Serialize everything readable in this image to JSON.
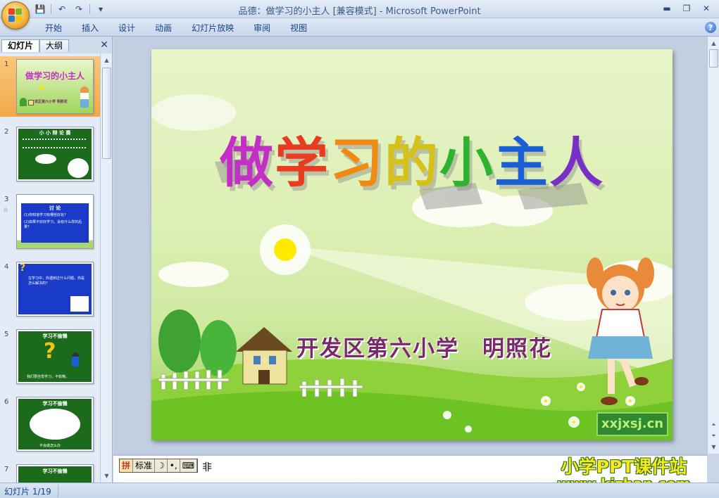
{
  "window": {
    "title": "品德：做学习的小主人 [兼容模式] - Microsoft PowerPoint",
    "minimize": "▬",
    "restore": "❐",
    "close": "✕"
  },
  "qat": {
    "save": "💾",
    "undo": "↶",
    "redo": "↷",
    "customize": "▾"
  },
  "ribbon": {
    "tabs": [
      "开始",
      "插入",
      "设计",
      "动画",
      "幻灯片放映",
      "审阅",
      "视图"
    ],
    "help": "?"
  },
  "left_panel": {
    "tabs": [
      "幻灯片",
      "大纲"
    ],
    "close": "✕",
    "thumbnails": [
      {
        "num": "1",
        "title": "做学习的小主人",
        "subtitle": "开发区第六小学 明照花"
      },
      {
        "num": "2",
        "title": "小 小 辩 论 赛"
      },
      {
        "num": "3",
        "title": "讨 论",
        "lines": [
          "(1)你知道学习有哪些好处？",
          "(2)如果不好好学习，会有什么样的后果？"
        ]
      },
      {
        "num": "4",
        "lines": [
          "在学习中，你遇到过什么问题，你是怎么解决的？"
        ]
      },
      {
        "num": "5",
        "title": "学习不偷懒",
        "lines": [
          "我们要自觉学习，不偷懒。"
        ]
      },
      {
        "num": "6",
        "title": "学习不偷懒",
        "lines": [
          "不会做怎么办"
        ]
      },
      {
        "num": "7",
        "title": "学习不偷懒"
      }
    ]
  },
  "slide": {
    "title_chars": [
      "做",
      "学",
      "习",
      "的",
      "小",
      "主",
      "人"
    ],
    "title_colors": [
      "#c22fc4",
      "#e83b1f",
      "#f08a12",
      "#d4c21a",
      "#2fb22f",
      "#1a5ed6",
      "#7a2fc4"
    ],
    "subtitle": "开发区第六小学　明照花",
    "watermark": "xxjxsj.cn"
  },
  "notes": {
    "ime": [
      "标准",
      "☽",
      "•,",
      "⌨"
    ],
    "ime_logo": "拼",
    "text": "非"
  },
  "brand": {
    "line1": "小学PPT课件站",
    "line2": "www.kjzhan.com"
  },
  "status": {
    "slide_info": "幻灯片 1/19"
  }
}
